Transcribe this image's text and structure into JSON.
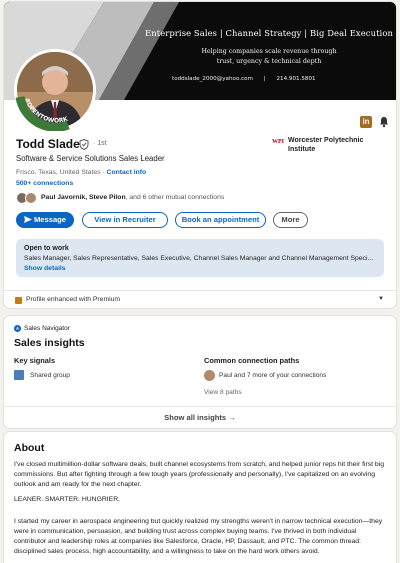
{
  "banner": {
    "title": "Enterprise Sales | Channel Strategy | Big Deal Execution",
    "subtitle_line1": "Helping companies scale revenue through",
    "subtitle_line2": "trust, urgency & technical depth",
    "email": "toddslade_2000@yahoo.com",
    "separator": "|",
    "phone": "214.901.5801"
  },
  "profile": {
    "avatar_badge": "#OPENTOWORK",
    "name": "Todd Slade",
    "degree": "· 1st",
    "headline": "Software & Service Solutions Sales Leader",
    "location": "Frisco, Texas, United States",
    "location_sep": " · ",
    "contact_info": "Contact info",
    "connections": "500+ connections",
    "education": "Worcester Polytechnic Institute",
    "edu_logo_text": "WPI",
    "mutual_names": "Paul Javornik, Steve Pilon",
    "mutual_rest": ", and 6 other mutual connections"
  },
  "actions": {
    "message": "Message",
    "recruiter": "View in Recruiter",
    "appointment": "Book an appointment",
    "more": "More"
  },
  "open_to_work": {
    "title": "Open to work",
    "description": "Sales Manager, Sales Representative, Sales Executive, Channel Sales Manager and Channel Management Speci...",
    "link": "Show details"
  },
  "premium": {
    "text": "Profile enhanced with Premium"
  },
  "sales_insights": {
    "brand": "Sales Navigator",
    "title": "Sales insights",
    "key_signals_heading": "Key signals",
    "key_signal_item": "Shared group",
    "paths_heading": "Common connection paths",
    "path_item": "Paul and 7 more of your connections",
    "paths_link": "View 8 paths",
    "footer": "Show all insights →"
  },
  "about": {
    "title": "About",
    "p1": "I've closed multimillion-dollar software deals, built channel ecosystems from scratch, and helped junior reps hit their first big commissions. But after fighting through a few tough years (professionally and personally), I've capitalized on an evolving outlook and am ready for the next chapter.",
    "p2": "LEANER. SMARTER. HUNGRIER.",
    "p3": "I started my career in aerospace engineering but quickly realized my strengths weren't in narrow technical execution—they were in communication, persuasion, and building trust across complex buying teams. I've thrived in both individual contributor and leadership roles at companies like Salesforce, Oracle, HP, Dassault, and PTC. The common thread: disciplined sales process, high accountability, and a willingness to take on the hard work others avoid."
  },
  "colors": {
    "accent": "#0a66c2",
    "open_to_work_green": "#3d7a3a",
    "premium_gold": "#c37d16"
  }
}
